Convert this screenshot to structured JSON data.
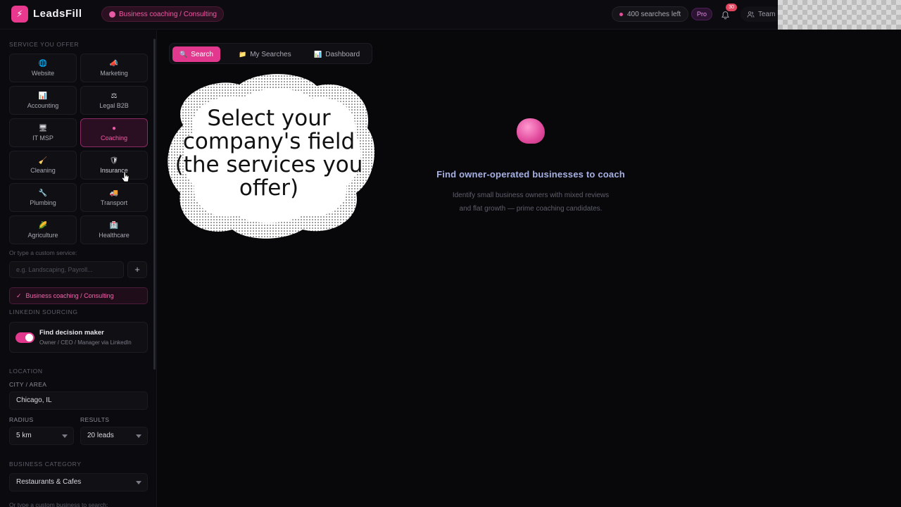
{
  "app": {
    "logo_glyph": "⚡",
    "name": "LeadsFill",
    "selected_service_chip": "Business coaching / Consulting",
    "searches_left": "400 searches left",
    "plan": "Pro",
    "notifications_count": "30",
    "team_label": "Team"
  },
  "sidebar": {
    "service_section_label": "SERVICE YOU OFFER",
    "services": [
      {
        "label": "Website",
        "icon": "globe-icon",
        "glyph": "🌐",
        "active": false
      },
      {
        "label": "Marketing",
        "icon": "megaphone-icon",
        "glyph": "📣",
        "active": false
      },
      {
        "label": "Accounting",
        "icon": "chart-icon",
        "glyph": "📊",
        "active": false
      },
      {
        "label": "Legal B2B",
        "icon": "scales-icon",
        "glyph": "⚖",
        "active": false
      },
      {
        "label": "IT MSP",
        "icon": "computer-icon",
        "glyph": "🖥",
        "active": false
      },
      {
        "label": "Coaching",
        "icon": "brain-icon",
        "glyph": "●",
        "active": true
      },
      {
        "label": "Cleaning",
        "icon": "broom-icon",
        "glyph": "🧹",
        "active": false
      },
      {
        "label": "Insurance",
        "icon": "shield-icon",
        "glyph": "🛡",
        "active": false
      },
      {
        "label": "Plumbing",
        "icon": "wrench-icon",
        "glyph": "🔧",
        "active": false
      },
      {
        "label": "Transport",
        "icon": "truck-icon",
        "glyph": "🚚",
        "active": false
      },
      {
        "label": "Agriculture",
        "icon": "corn-icon",
        "glyph": "🌽",
        "active": false
      },
      {
        "label": "Healthcare",
        "icon": "medical-icon",
        "glyph": "🏥",
        "active": false
      }
    ],
    "custom_hint": "Or type a custom service:",
    "custom_placeholder": "e.g. Landscaping, Payroll...",
    "add_label": "+",
    "selected_service": "Business coaching / Consulting",
    "selected_check": "✓",
    "linkedin_section_label": "LINKEDIN SOURCING",
    "linkedin_title": "Find decision maker",
    "linkedin_sub": "Owner / CEO / Manager via LinkedIn",
    "linkedin_enabled": true,
    "location_section_label": "LOCATION",
    "city_label": "CITY / AREA",
    "city_value": "Chicago, IL",
    "radius_label": "RADIUS",
    "radius_value": "5 km",
    "results_label": "RESULTS",
    "results_value": "20 leads",
    "category_section_label": "BUSINESS CATEGORY",
    "category_value": "Restaurants & Cafes",
    "category_hint": "Or type a custom business to search:"
  },
  "main": {
    "tabs": [
      {
        "label": "Search",
        "glyph": "🔍",
        "active": true
      },
      {
        "label": "My Searches",
        "glyph": "📁",
        "active": false
      },
      {
        "label": "Dashboard",
        "glyph": "📊",
        "active": false
      }
    ],
    "empty_title": "Find owner-operated businesses to coach",
    "empty_desc": "Identify small business owners with mixed reviews and flat growth — prime coaching candidates."
  },
  "callout": {
    "text": "Select your company's field (the services you offer)"
  },
  "colors": {
    "accent": "#e2398f",
    "background": "#08080b",
    "title_blue": "#a8b1e4"
  }
}
